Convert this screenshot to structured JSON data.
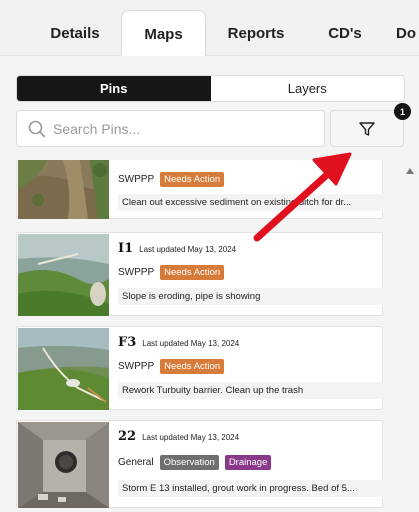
{
  "tabs": [
    {
      "label": "Details"
    },
    {
      "label": "Maps"
    },
    {
      "label": "Reports"
    },
    {
      "label": "CD's"
    },
    {
      "label": "Do"
    }
  ],
  "segmented": {
    "pins_label": "Pins",
    "layers_label": "Layers",
    "active": "Pins"
  },
  "search": {
    "placeholder": "Search Pins..."
  },
  "filter": {
    "badge_count": "1",
    "icon": "filter-funnel-icon"
  },
  "colors": {
    "needs_action": "#d77b3a",
    "observation": "#6f6f6f",
    "drainage": "#8a3a8a",
    "arrow": "#e0101e"
  },
  "pins": [
    {
      "id": "",
      "updated": "",
      "category": "SWPPP",
      "status": "Needs Action",
      "extra_tag": "",
      "note": "Clean out excessive sediment on existing ditch for dr..."
    },
    {
      "id": "I1",
      "updated": "Last updated May 13, 2024",
      "category": "SWPPP",
      "status": "Needs Action",
      "extra_tag": "",
      "note": "Slope is eroding, pipe is showing"
    },
    {
      "id": "F3",
      "updated": "Last updated May 13, 2024",
      "category": "SWPPP",
      "status": "Needs Action",
      "extra_tag": "",
      "note": "Rework Turbuity barrier. Clean up the trash"
    },
    {
      "id": "22",
      "updated": "Last updated May 13, 2024",
      "category": "General",
      "status": "Observation",
      "extra_tag": "Drainage",
      "note": "Storm E 13 installed, grout work in progress. Bed of 5..."
    }
  ]
}
